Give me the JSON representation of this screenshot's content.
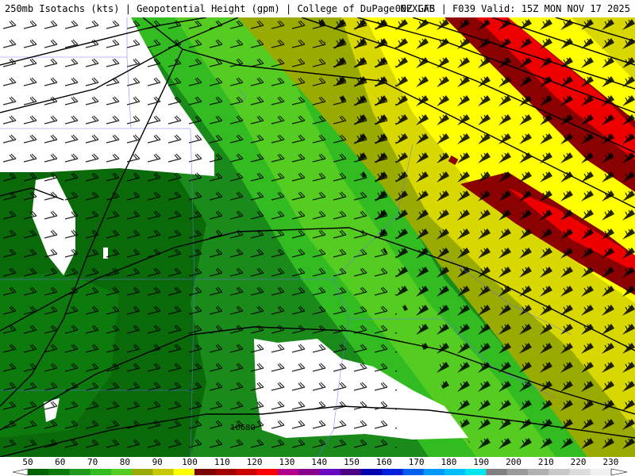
{
  "header": {
    "left": "250mb Isotachs (kts) | Geopotential Height (gpm) | College of DuPage NEXLAB",
    "right": "00Z GFS | F039 Valid: 15Z MON NOV 17 2025"
  },
  "map": {
    "contour_label": "10680"
  },
  "legend": {
    "labels": [
      "50",
      "60",
      "70",
      "80",
      "90",
      "100",
      "110",
      "120",
      "130",
      "140",
      "150",
      "160",
      "170",
      "180",
      "190",
      "200",
      "210",
      "220",
      "230"
    ],
    "colors": [
      "#006400",
      "#0a7a0a",
      "#1f9a1f",
      "#33bb22",
      "#55cc22",
      "#99aa00",
      "#c8c800",
      "#ffff00",
      "#7a0000",
      "#a00000",
      "#cc0000",
      "#ff0000",
      "#b0008a",
      "#8b008b",
      "#6a0ac0",
      "#4b0082",
      "#0000b0",
      "#0020dd",
      "#0060ee",
      "#0099ff",
      "#00bfff",
      "#00e5ee",
      "#808080",
      "#9a9a9a",
      "#b0b0b0",
      "#c8c8c8",
      "#dcdcdc",
      "#f0f0f0"
    ]
  }
}
